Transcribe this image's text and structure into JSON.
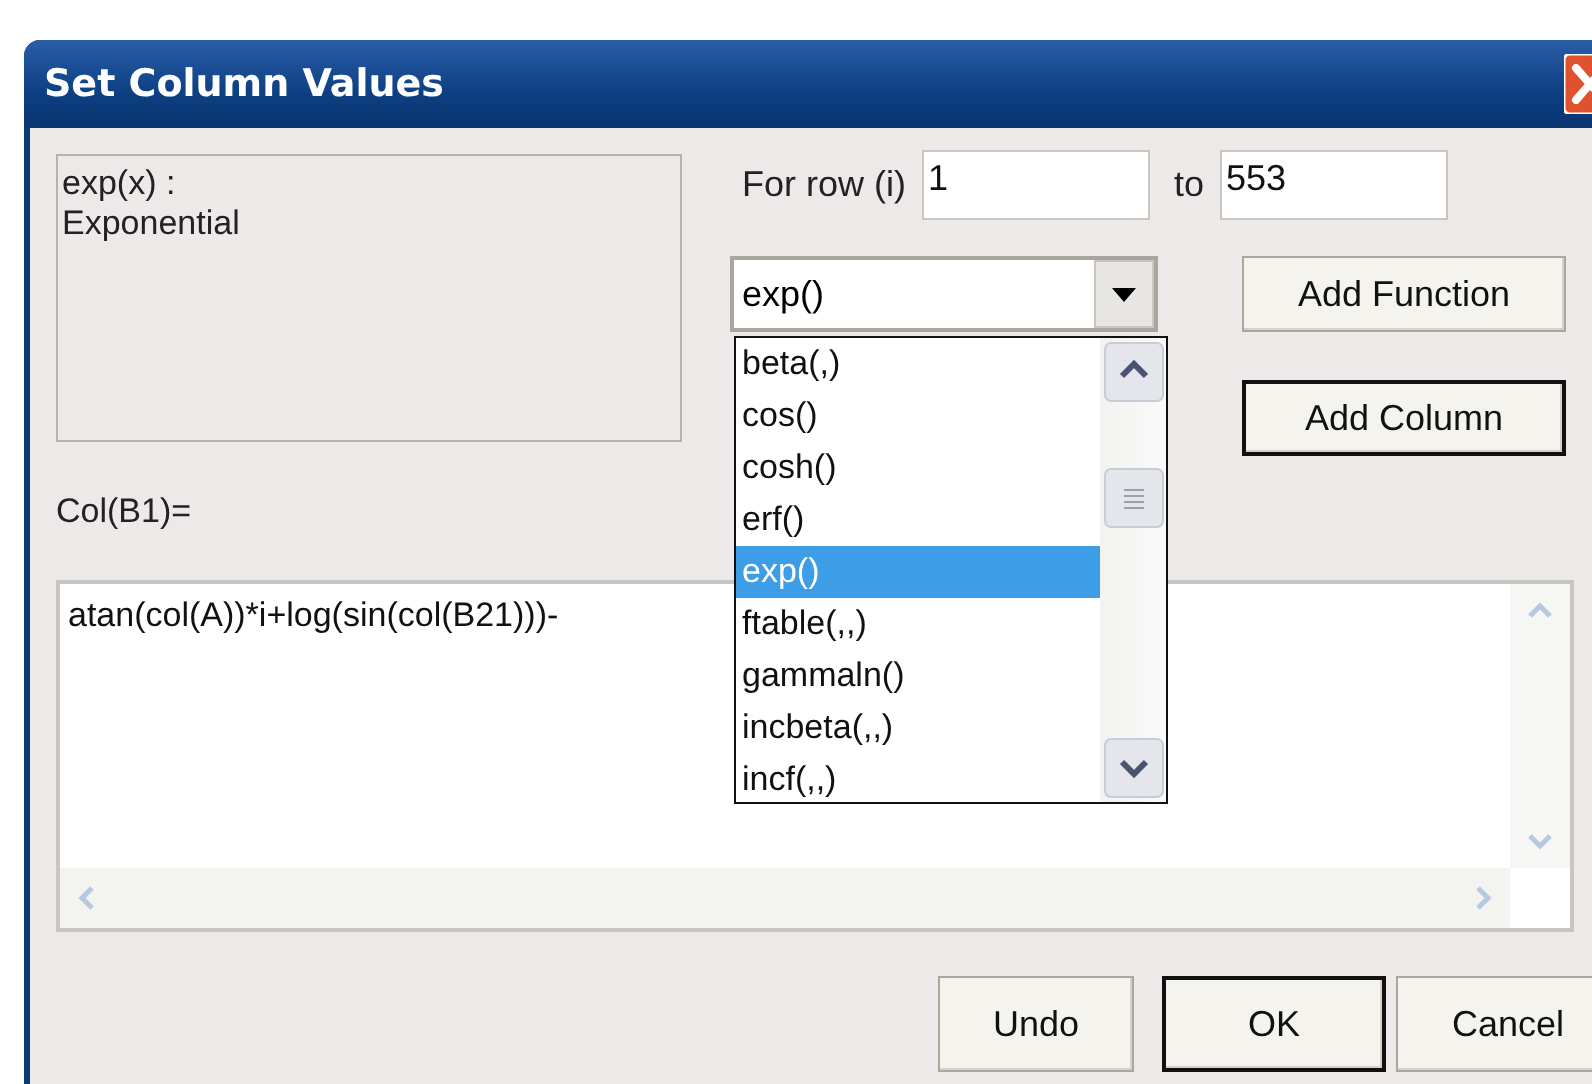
{
  "window": {
    "title": "Set Column Values"
  },
  "description": {
    "lines": [
      "exp(x) :",
      "Exponential"
    ]
  },
  "row_range": {
    "label": "For row (i)",
    "from": "1",
    "to_label": "to",
    "to": "553"
  },
  "function_combo": {
    "value": "exp()",
    "expanded": true,
    "options": [
      {
        "label": "beta(,)",
        "selected": false
      },
      {
        "label": "cos()",
        "selected": false
      },
      {
        "label": "cosh()",
        "selected": false
      },
      {
        "label": "erf()",
        "selected": false
      },
      {
        "label": "exp()",
        "selected": true
      },
      {
        "label": "ftable(,,)",
        "selected": false
      },
      {
        "label": "gammaln()",
        "selected": false
      },
      {
        "label": "incbeta(,,)",
        "selected": false
      },
      {
        "label": "incf(,,)",
        "selected": false
      }
    ]
  },
  "side_buttons": [
    {
      "label": "Add Function",
      "default": false
    },
    {
      "label": "Add Column",
      "default": true
    }
  ],
  "formula_label": "Col(B1)=",
  "formula": "atan(col(A))*i+log(sin(col(B21)))-",
  "buttons": [
    {
      "label": "Undo",
      "default": false
    },
    {
      "label": "OK",
      "default": true
    },
    {
      "label": "Cancel",
      "default": false
    }
  ]
}
